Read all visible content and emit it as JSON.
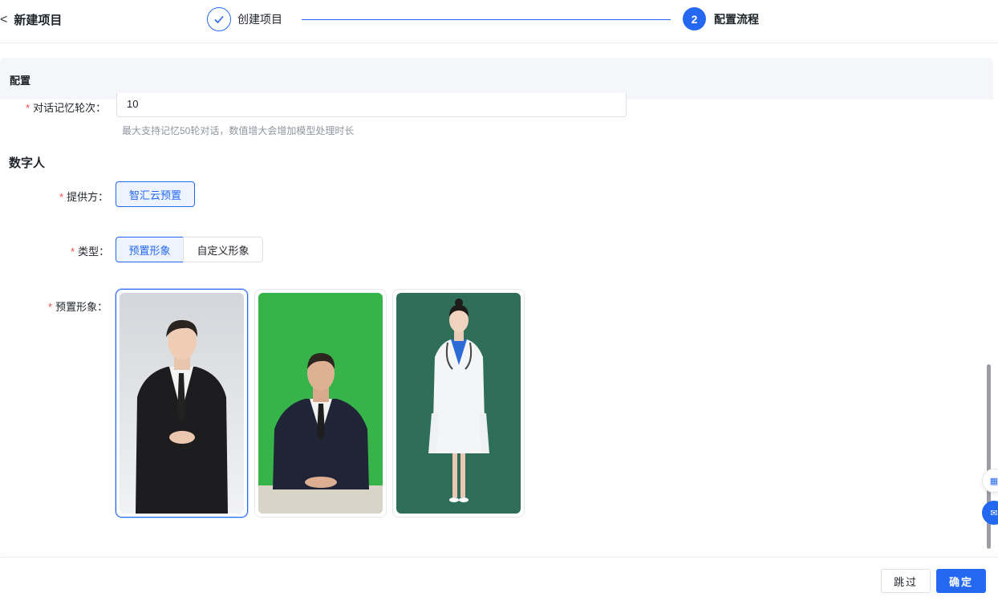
{
  "header": {
    "back_label": "新建项目",
    "steps": [
      {
        "number": "1",
        "label": "创建项目",
        "status": "done"
      },
      {
        "number": "2",
        "label": "配置流程",
        "status": "active"
      }
    ]
  },
  "config": {
    "section_title": "配置",
    "memory": {
      "label": "对话记忆轮次：",
      "value": "10",
      "hint": "最大支持记忆50轮对话，数值增大会增加模型处理时长"
    }
  },
  "digital_human": {
    "title": "数字人",
    "provider": {
      "label": "提供方：",
      "options": [
        "智汇云预置"
      ],
      "selected": "智汇云预置"
    },
    "type": {
      "label": "类型：",
      "options": [
        "预置形象",
        "自定义形象"
      ],
      "selected": "预置形象"
    },
    "avatar": {
      "label": "预置形象：",
      "cards": [
        {
          "name": "young man in black suit",
          "background": "#dfe1e6",
          "selected": true
        },
        {
          "name": "man in suit seated, green screen",
          "background": "#33b34a",
          "selected": false
        },
        {
          "name": "female doctor in white coat",
          "background": "#2f6f5a",
          "selected": false
        }
      ]
    }
  },
  "footer": {
    "skip_label": "跳过",
    "confirm_label": "确定"
  },
  "colors": {
    "accent": "#2468f2",
    "required": "#f54a45"
  }
}
